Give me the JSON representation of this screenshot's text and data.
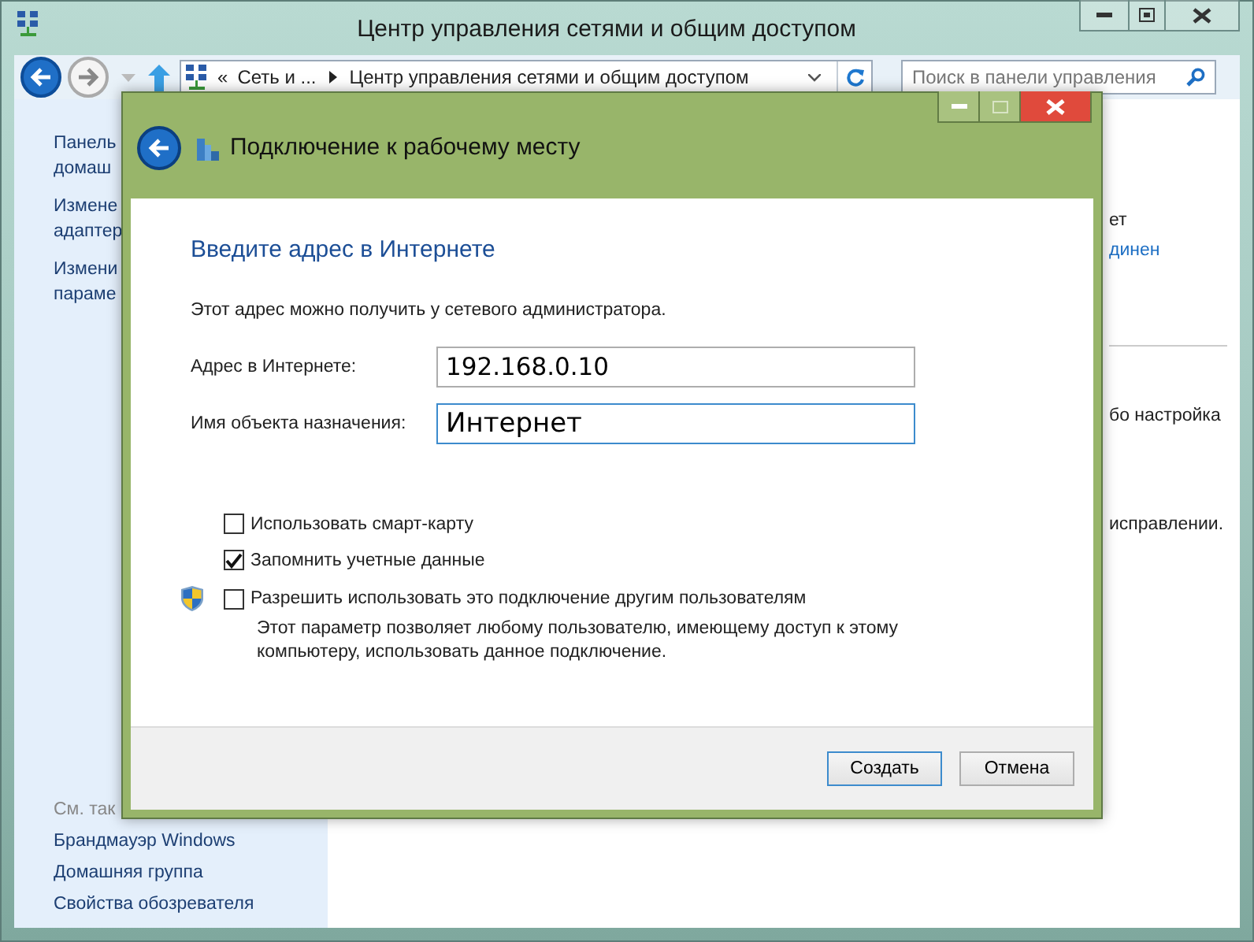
{
  "window": {
    "title": "Центр управления сетями и общим доступом"
  },
  "address_bar": {
    "overflow": "«",
    "crumbs": [
      "Сеть и ...",
      "Центр управления сетями и общим доступом"
    ]
  },
  "search": {
    "placeholder": "Поиск в панели управления"
  },
  "sidebar": {
    "items": [
      {
        "text": "Панель\nдомаш"
      },
      {
        "text": "Измене\nадаптер"
      },
      {
        "text": "Измени\nпараме"
      }
    ],
    "see_also_heading": "См. так",
    "see_also": [
      "Брандмауэр Windows",
      "Домашняя группа",
      "Свойства обозревателя"
    ]
  },
  "content_fragments": [
    {
      "text": "ет",
      "kind": "text"
    },
    {
      "text": "динен",
      "kind": "link"
    },
    {
      "text": "бо настройка",
      "kind": "text"
    },
    {
      "text": "исправлении.",
      "kind": "text"
    }
  ],
  "dialog": {
    "title": "Подключение к рабочему месту",
    "heading": "Введите адрес в Интернете",
    "description": "Этот адрес можно получить у сетевого администратора.",
    "fields": [
      {
        "label": "Адрес в Интернете:",
        "value": "192.168.0.10",
        "focused": false
      },
      {
        "label": "Имя объекта назначения:",
        "value": "Интернет",
        "focused": true
      }
    ],
    "options": [
      {
        "label": "Использовать смарт-карту",
        "checked": false,
        "shield": false
      },
      {
        "label": "Запомнить учетные данные",
        "checked": true,
        "shield": false
      },
      {
        "label": "Разрешить использовать это подключение другим пользователям",
        "checked": false,
        "shield": true
      }
    ],
    "note": "Этот параметр позволяет любому пользователю, имеющему доступ к этому компьютеру, использовать данное подключение.",
    "buttons": [
      {
        "label": "Создать",
        "default": true
      },
      {
        "label": "Отмена",
        "default": false
      }
    ]
  }
}
